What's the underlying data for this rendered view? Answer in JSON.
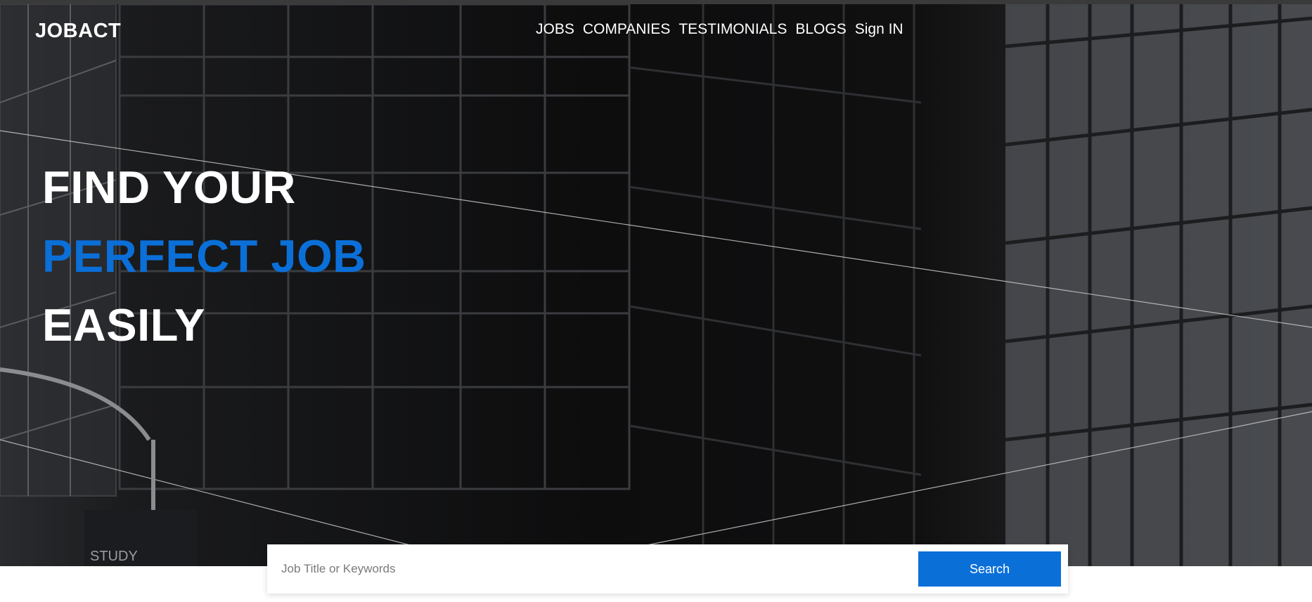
{
  "brand": {
    "name": "JOBACT"
  },
  "nav": {
    "items": [
      {
        "label": "JOBS"
      },
      {
        "label": "COMPANIES"
      },
      {
        "label": "TESTIMONIALS"
      },
      {
        "label": "BLOGS"
      },
      {
        "label": "Sign IN"
      }
    ]
  },
  "hero": {
    "line1": "FIND YOUR",
    "line2": "PERFECT JOB",
    "line3": "EASILY"
  },
  "search": {
    "placeholder": "Job Title or Keywords",
    "button_label": "Search"
  },
  "colors": {
    "accent": "#0b6fd8",
    "text_light": "#ffffff",
    "hero_bg": "#0b0b0c"
  }
}
